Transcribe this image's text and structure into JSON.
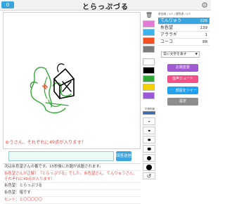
{
  "app": {
    "title": "とらっぷづる",
    "score_badge": "0",
    "gear_icon": "⚙"
  },
  "canvas": {
    "marquee": "ゅうさん、それぞれに49点が入ります！",
    "marquee_color": "#e2504a"
  },
  "answer": {
    "placeholder": "",
    "submit_label": "回答送信"
  },
  "chat": {
    "lines": [
      {
        "text": "次は糸色望さんの番です。15秒後にお題が出題されます。",
        "style": "system"
      },
      {
        "text": "糸色望さんが正解！「とらっぷづる」でした。糸色望さん、てんりゅうさん、それぞれに49点が入ります！",
        "style": "red"
      },
      {
        "text": "糸色望：とらっぷづる",
        "style": "system"
      },
      {
        "text": "糸色望：暗です",
        "style": "system"
      },
      {
        "text": "ヒント：と〇〇〇〇〇",
        "style": "red"
      }
    ]
  },
  "tools": {
    "trash_icon": "🗑",
    "width_label": "不透明度",
    "undo_icon": "↺",
    "palette": [
      "#e37ad6",
      "#3bb4ed",
      "#f2501e",
      "#7d7d7d",
      "#ffffff",
      "#000000",
      "#33a838",
      "#f5d000",
      "#9a57d8"
    ]
  },
  "side": {
    "header": "参加者 / 3人 / 観覧者 / 0人",
    "players": [
      {
        "name": "てんりゅう",
        "score": "226",
        "active": true
      },
      {
        "name": "糸色望",
        "score": "139",
        "active": false
      },
      {
        "name": "アララギ",
        "score": "1",
        "active": false
      },
      {
        "name": "ユーコ",
        "score": "88",
        "active": false
      }
    ],
    "select_value": "常に文字を表す",
    "buttons": {
      "pass": "お題変更",
      "mute": "音声ミュート",
      "tweet": "部屋をツイート",
      "settings": "設定"
    }
  },
  "colors": {
    "accent": "#3aa6df",
    "purple": "#a05bd2",
    "pink": "#f25286",
    "twitter": "#1da1f2",
    "gray": "#8d8d8d"
  }
}
